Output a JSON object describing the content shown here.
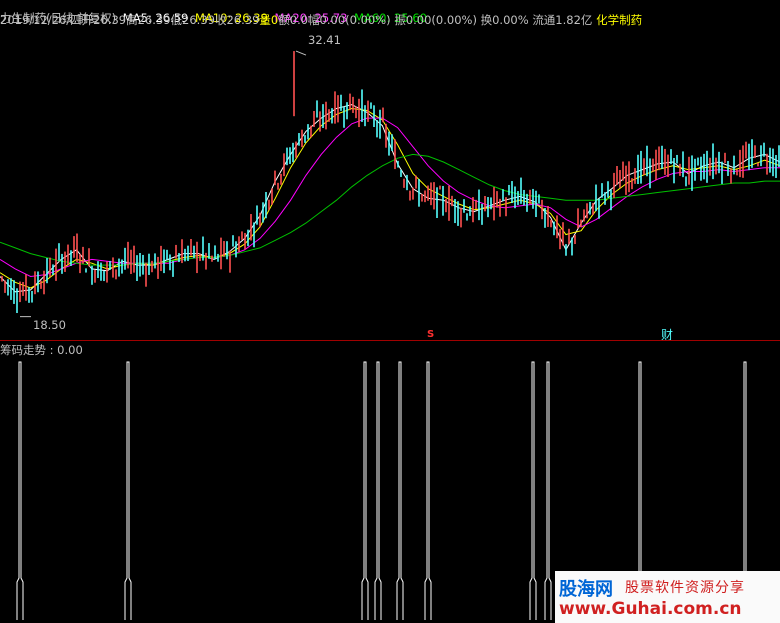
{
  "header": {
    "stock_title": "力生制药(日线,前复权)",
    "ma5": "MA5: 26.59",
    "ma10": "MA10: 26.39",
    "ma20": "MA20: 25.73",
    "ma60": "MA60: 25.60",
    "date": "2019/12/26/四",
    "open": "开26.39",
    "high": "高26.39",
    "low": "低26.39",
    "close": "收26.39",
    "volume": "量0",
    "amount": "额0.0",
    "change": "幅0.00(0.00%)",
    "amplitude": "振0.00(0.00%)",
    "turnover": "换0.00%",
    "float": "流通1.82亿",
    "sector": "化学制药"
  },
  "main_chart": {
    "high_label": "32.41",
    "low_label": "18.50",
    "marker_s": "S",
    "marker_cai": "财"
  },
  "sub_chart": {
    "title": "筹码走势 : 0.00"
  },
  "watermark": {
    "logo": "股海网",
    "slogan": "股票软件资源分享",
    "url": "www.Guhai.com.cn"
  },
  "colors": {
    "background": "#000000",
    "ma5": "#ffffff",
    "ma10": "#ffff00",
    "ma20": "#ff00ff",
    "ma60": "#00c000",
    "up": "#ff5050",
    "down": "#54ffff",
    "divider": "#a00000",
    "signal": "#ffffff"
  },
  "chart_data": {
    "type": "line",
    "ylim": [
      18.5,
      32.41
    ],
    "annotations": [
      "32.41",
      "18.50"
    ],
    "series": [
      {
        "name": "MA5",
        "values": [
          20.6,
          19.8,
          19.9,
          20.7,
          21.5,
          22.0,
          21.0,
          20.9,
          21.4,
          21.2,
          21.2,
          21.5,
          21.8,
          21.8,
          21.5,
          21.9,
          22.6,
          23.8,
          25.6,
          27.0,
          28.2,
          28.9,
          29.4,
          29.6,
          29.2,
          28.5,
          26.5,
          25.2,
          24.7,
          24.6,
          24.2,
          24.0,
          24.3,
          24.6,
          24.8,
          24.5,
          23.7,
          22.0,
          23.4,
          24.6,
          25.2,
          25.9,
          26.2,
          26.5,
          26.6,
          26.0,
          26.4,
          26.6,
          26.3,
          26.8,
          27.0,
          26.6
        ]
      },
      {
        "name": "MA10",
        "values": [
          20.8,
          20.3,
          20.0,
          20.4,
          21.0,
          21.5,
          21.3,
          21.0,
          21.2,
          21.3,
          21.2,
          21.4,
          21.6,
          21.7,
          21.6,
          21.8,
          22.3,
          23.2,
          24.7,
          26.3,
          27.6,
          28.5,
          29.1,
          29.4,
          29.3,
          28.8,
          27.5,
          26.0,
          25.2,
          24.8,
          24.4,
          24.1,
          24.2,
          24.4,
          24.6,
          24.4,
          23.9,
          22.8,
          23.0,
          24.1,
          24.9,
          25.5,
          25.9,
          26.2,
          26.4,
          26.2,
          26.3,
          26.4,
          26.2,
          26.4,
          26.7,
          26.4
        ]
      },
      {
        "name": "MA20",
        "values": [
          21.5,
          21.0,
          20.6,
          20.7,
          21.0,
          21.3,
          21.5,
          21.4,
          21.3,
          21.3,
          21.3,
          21.3,
          21.5,
          21.6,
          21.6,
          21.7,
          22.0,
          22.6,
          23.5,
          24.6,
          25.9,
          27.0,
          27.9,
          28.6,
          28.9,
          28.9,
          28.4,
          27.4,
          26.4,
          25.6,
          25.0,
          24.6,
          24.3,
          24.2,
          24.3,
          24.4,
          24.2,
          23.6,
          23.2,
          23.6,
          24.2,
          24.8,
          25.3,
          25.7,
          26.0,
          26.1,
          26.1,
          26.2,
          26.1,
          26.2,
          26.3,
          26.3
        ]
      },
      {
        "name": "MA60",
        "values": [
          22.4,
          22.1,
          21.8,
          21.6,
          21.4,
          21.3,
          21.2,
          21.2,
          21.2,
          21.3,
          21.3,
          21.4,
          21.5,
          21.6,
          21.6,
          21.7,
          21.9,
          22.1,
          22.5,
          22.9,
          23.4,
          24.0,
          24.6,
          25.3,
          25.9,
          26.4,
          26.8,
          27.0,
          26.9,
          26.6,
          26.2,
          25.8,
          25.4,
          25.1,
          24.9,
          24.8,
          24.7,
          24.6,
          24.6,
          24.6,
          24.7,
          24.8,
          24.9,
          25.0,
          25.1,
          25.2,
          25.3,
          25.4,
          25.5,
          25.5,
          25.6,
          25.6
        ]
      }
    ],
    "signals": {
      "x": [
        20,
        128,
        365,
        378,
        400,
        428,
        533,
        548,
        640,
        745
      ]
    }
  }
}
